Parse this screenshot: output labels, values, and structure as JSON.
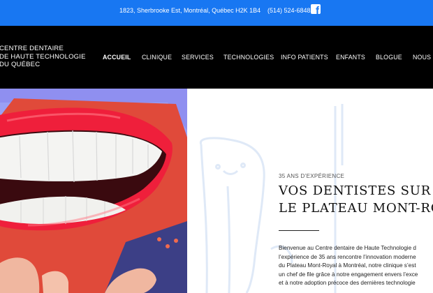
{
  "topbar": {
    "address": "1823, Sherbrooke Est, Montréal, Québec H2K 1B4",
    "phone": "(514) 524-6848",
    "facebook_icon": "facebook-icon",
    "bg_color": "#1877f2"
  },
  "logo": {
    "line1": "CENTRE DENTAIRE",
    "line2": "DE HAUTE TECHNOLOGIE",
    "line3": "DU QUÉBEC"
  },
  "nav": {
    "items": [
      {
        "label": "ACCUEIL",
        "active": true
      },
      {
        "label": "CLINIQUE"
      },
      {
        "label": "SERVICES"
      },
      {
        "label": "TECHNOLOGIES"
      },
      {
        "label": "INFO PATIENTS"
      },
      {
        "label": "ENFANTS"
      },
      {
        "label": "BLOGUE"
      },
      {
        "label": "NOUS J"
      }
    ]
  },
  "hero": {
    "tagline": "35 ANS D’EXPÉRIENCE",
    "title_line1": "VOS DENTISTES SUR",
    "title_line2": "LE PLATEAU MONT-RO",
    "body_lines": [
      "Bienvenue au Centre dentaire de Haute Technologie d",
      "l’expérience de 35 ans rencontre l’innovation moderne",
      "du Plateau Mont-Royal à Montréal, notre clinique s’est",
      "un chef de file grâce à notre engagement envers l’exce",
      "et à notre adoption précoce des dernières technologie"
    ]
  }
}
